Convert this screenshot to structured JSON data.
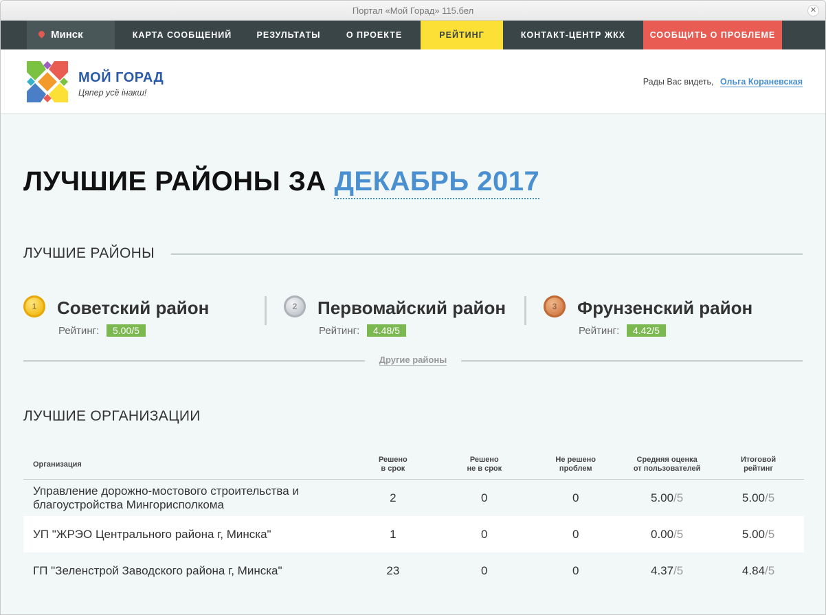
{
  "window": {
    "title": "Портал «Мой Горад» 115.бел"
  },
  "nav": {
    "city": "Минск",
    "items": [
      "КАРТА СООБЩЕНИЙ",
      "РЕЗУЛЬТАТЫ",
      "О ПРОЕКТЕ",
      "РЕЙТИНГ",
      "КОНТАКТ-ЦЕНТР ЖКХ",
      "СООБЩИТЬ О ПРОБЛЕМЕ"
    ],
    "active": "РЕЙТИНГ"
  },
  "header": {
    "logo_title": "МОЙ ГОРАД",
    "logo_subtitle": "Цяпер усё інакш!",
    "greeting": "Рады Вас видеть,",
    "user_name": "Ольга Кораневская"
  },
  "page": {
    "title_prefix": "ЛУЧШИЕ РАЙОНЫ ЗА",
    "title_month": "ДЕКАБРЬ 2017"
  },
  "districts_section": {
    "heading": "ЛУЧШИЕ РАЙОНЫ",
    "rating_label": "Рейтинг:",
    "items": [
      {
        "rank": "1",
        "name": "Советский район",
        "rating": "5.00/5",
        "medal": "gold"
      },
      {
        "rank": "2",
        "name": "Первомайский район",
        "rating": "4.48/5",
        "medal": "silver"
      },
      {
        "rank": "3",
        "name": "Фрунзенский район",
        "rating": "4.42/5",
        "medal": "bronze"
      }
    ],
    "others_link": "Другие районы"
  },
  "orgs_section": {
    "heading": "ЛУЧШИЕ ОРГАНИЗАЦИИ",
    "columns": [
      "Организация",
      "Решено\nв срок",
      "Решено\nне в срок",
      "Не решено\nпроблем",
      "Средняя оценка\nот пользователей",
      "Итоговой\nрейтинг"
    ],
    "rows": [
      {
        "org": "Управление дорожно-мостового строительства и благоустройства Мингорисполкома",
        "on_time": "2",
        "late": "0",
        "unsolved": "0",
        "avg": "5.00",
        "avg_max": "/5",
        "total": "5.00",
        "total_max": "/5"
      },
      {
        "org": "УП \"ЖРЭО Центрального района г, Минска\"",
        "on_time": "1",
        "late": "0",
        "unsolved": "0",
        "avg": "0.00",
        "avg_max": "/5",
        "total": "5.00",
        "total_max": "/5"
      },
      {
        "org": "ГП \"Зеленстрой Заводского района г, Минска\"",
        "on_time": "23",
        "late": "0",
        "unsolved": "0",
        "avg": "4.37",
        "avg_max": "/5",
        "total": "4.84",
        "total_max": "/5"
      }
    ]
  }
}
